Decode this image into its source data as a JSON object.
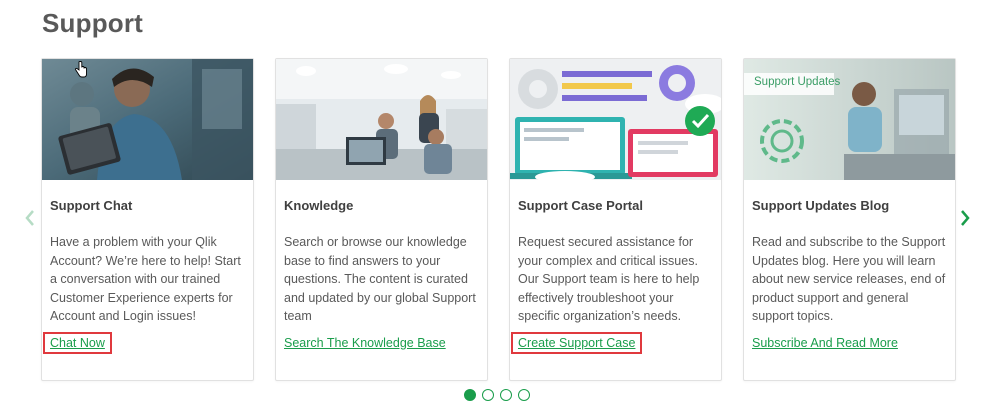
{
  "section": {
    "title": "Support"
  },
  "carousel": {
    "prev_icon": "chevron-left-icon",
    "next_icon": "chevron-right-icon",
    "accent_color": "#1a9d4b",
    "active_dot": 0,
    "dot_count": 4
  },
  "cards": [
    {
      "title": "Support Chat",
      "text": "Have a problem with your Qlik Account? We’re here to help! Start a conversation with our trained Customer Experience experts for Account and Login issues!",
      "link": "Chat Now",
      "image": "person-with-tablet-photo"
    },
    {
      "title": "Knowledge",
      "text": "Search or browse our knowledge base to find answers to your questions. The content is curated and updated by our global Support team",
      "link": "Search The Knowledge Base",
      "image": "office-team-photo"
    },
    {
      "title": "Support Case Portal",
      "text": "Request secured assistance for your complex and critical issues. Our Support team is here to help effectively troubleshoot your specific organization’s needs.",
      "link": "Create Support Case",
      "image": "laptop-checkmark-illustration"
    },
    {
      "title": "Support Updates Blog",
      "text": "Read and subscribe to the Support Updates blog. Here you will learn about new service releases, end of product support and general support topics.",
      "link": "Subscribe And Read More",
      "image_label": "Support Updates",
      "image": "support-agent-photo"
    }
  ]
}
